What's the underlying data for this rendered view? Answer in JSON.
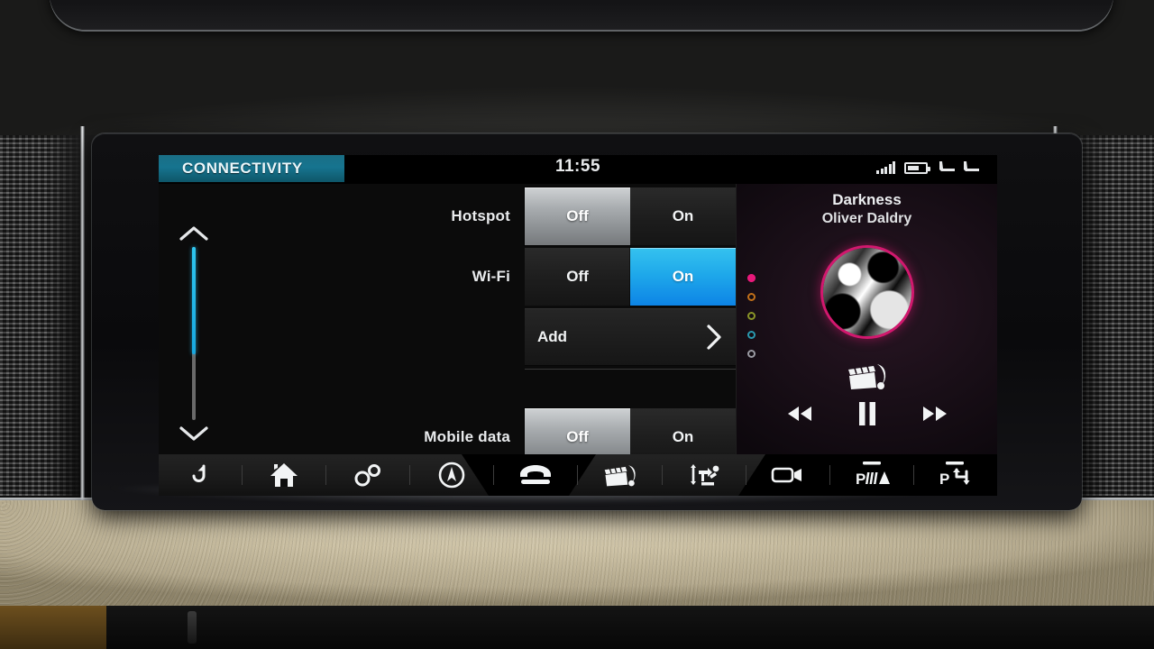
{
  "screen": {
    "status": {
      "tab_title": "CONNECTIVITY",
      "clock": "11:55",
      "signal_icon": "signal-bars-icon",
      "battery_icon": "battery-icon",
      "seat_left_icon": "seat-heater-left-icon",
      "seat_right_icon": "seat-heater-right-icon"
    },
    "scroll": {
      "up_icon": "chevron-up-icon",
      "down_icon": "chevron-down-icon",
      "fill_percent": 62
    },
    "settings_rows": [
      {
        "label": "Hotspot",
        "type": "toggle",
        "options": [
          "Off",
          "On"
        ],
        "selected": "Off",
        "accent": "gray"
      },
      {
        "label": "Wi-Fi",
        "type": "toggle",
        "options": [
          "Off",
          "On"
        ],
        "selected": "On",
        "accent": "blue"
      },
      {
        "label": "",
        "type": "action",
        "action_label": "Add",
        "chevron_icon": "chevron-right-icon"
      },
      {
        "label": "Mobile data",
        "type": "toggle",
        "options": [
          "Off",
          "On"
        ],
        "selected": "Off",
        "accent": "gray"
      }
    ],
    "media": {
      "track_title": "Darkness",
      "artist": "Oliver Daldry",
      "album_art_name": "album-artwork",
      "source_icon": "media-clapperboard-icon",
      "prev_icon": "previous-track-icon",
      "play_pause_icon": "pause-icon",
      "next_icon": "next-track-icon",
      "preset_dots": [
        {
          "name": "preset-dot-1",
          "color": "#e8197a",
          "active": true
        },
        {
          "name": "preset-dot-2",
          "color": "#c2701a",
          "active": false
        },
        {
          "name": "preset-dot-3",
          "color": "#8a9428",
          "active": false
        },
        {
          "name": "preset-dot-4",
          "color": "#2a9ab0",
          "active": false
        },
        {
          "name": "preset-dot-5",
          "color": "#9b9ba3",
          "active": false
        }
      ]
    },
    "navbar": [
      {
        "name": "back-icon",
        "label": "Back"
      },
      {
        "name": "home-icon",
        "label": "Home"
      },
      {
        "name": "settings-gears-icon",
        "label": "Settings"
      },
      {
        "name": "navigation-icon",
        "label": "Navigation"
      },
      {
        "name": "phone-icon",
        "label": "Phone"
      },
      {
        "name": "media-clapperboard-icon",
        "label": "Media"
      },
      {
        "name": "climate-seat-icon",
        "label": "Climate"
      },
      {
        "name": "camera-icon",
        "label": "Camera"
      },
      {
        "name": "park-sensor-icon",
        "label": "Park Distance"
      },
      {
        "name": "park-assist-icon",
        "label": "Park Assist"
      }
    ]
  },
  "colors": {
    "accent_blue": "#1fa9ea",
    "tab_teal": "#16748f",
    "media_pink": "#d2186e",
    "scroll_cyan": "#2ec6ef"
  }
}
